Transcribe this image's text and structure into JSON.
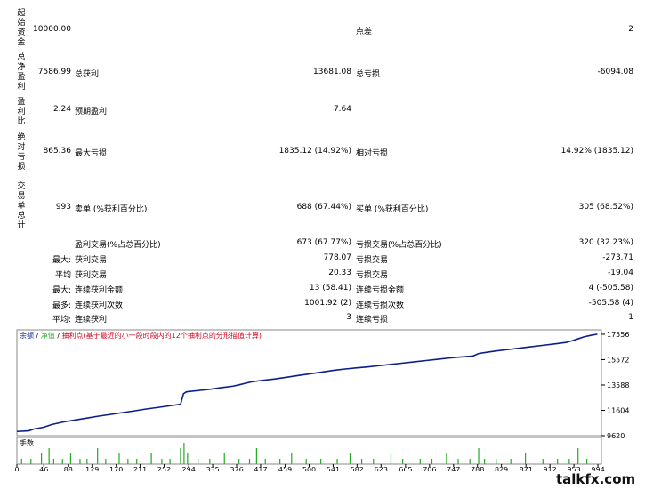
{
  "report": {
    "rows": [
      {
        "vlabel": "起始资金",
        "value": "10000.00",
        "c2label": "",
        "c2value": "",
        "c3label": "点差",
        "c3value": "2"
      },
      {
        "vlabel": "总净盈利",
        "value": "7586.99",
        "c2label": "总获利",
        "c2value": "13681.08",
        "c3label": "总亏损",
        "c3value": "-6094.08"
      },
      {
        "vlabel": "盈利比",
        "value": "2.24",
        "c2label": "预期盈利",
        "c2value": "7.64",
        "c3label": "",
        "c3value": ""
      },
      {
        "vlabel": "绝对亏损",
        "value": "865.36",
        "c2label": "最大亏损",
        "c2value": "1835.12 (14.92%)",
        "c3label": "相对亏损",
        "c3value": "14.92% (1835.12)"
      },
      {
        "vlabel": "交易单总计",
        "value": "993",
        "c2label": "卖单 (%获利百分比)",
        "c2value": "688 (67.44%)",
        "c3label": "买单 (%获利百分比)",
        "c3value": "305 (68.52%)"
      }
    ],
    "details": [
      {
        "prefix": "",
        "c2label": "盈利交易(%占总百分比)",
        "c2value": "673 (67.77%)",
        "c3label": "亏损交易(%占总百分比)",
        "c3value": "320 (32.23%)"
      },
      {
        "prefix": "最大:",
        "c2label": "获利交易",
        "c2value": "778.07",
        "c3label": "亏损交易",
        "c3value": "-273.71"
      },
      {
        "prefix": "平均",
        "c2label": "获利交易",
        "c2value": "20.33",
        "c3label": "亏损交易",
        "c3value": "-19.04"
      },
      {
        "prefix": "最大:",
        "c2label": "连续获利金额",
        "c2value": "13 (58.41)",
        "c3label": "连续亏损金额",
        "c3value": "4 (-505.58)"
      },
      {
        "prefix": "最多:",
        "c2label": "连续获利次数",
        "c2value": "1001.92 (2)",
        "c3label": "连续亏损次数",
        "c3value": "-505.58 (4)"
      },
      {
        "prefix": "平均:",
        "c2label": "连续获利",
        "c2value": "3",
        "c3label": "连续亏损",
        "c3value": "1"
      }
    ]
  },
  "chart": {
    "legend": {
      "balance": "余额",
      "sep1": " / ",
      "equity": "净值",
      "sep2": " / ",
      "drawdown": "抽利点(基于最近的小一段时段内的12个抽利点的分形描值计算)"
    },
    "volume_label": "手数",
    "colors": {
      "balance": "#0a1e8c",
      "equity": "#2ea82e",
      "drawdown": "#d0021b",
      "volume": "#22aa22",
      "border": "#888888"
    }
  },
  "chart_data": {
    "type": "line",
    "series": [
      {
        "x": [
          0,
          20,
          30,
          46,
          60,
          80,
          100,
          120,
          140,
          160,
          180,
          200,
          220,
          240,
          260,
          280,
          285,
          290,
          310,
          330,
          350,
          370,
          380,
          400,
          420,
          440,
          460,
          480,
          500,
          520,
          540,
          560,
          580,
          600,
          620,
          640,
          660,
          680,
          700,
          720,
          740,
          760,
          780,
          790,
          800,
          820,
          840,
          860,
          880,
          900,
          920,
          940,
          950,
          960,
          970,
          980,
          993
        ],
        "y": [
          9950,
          10000,
          10150,
          10280,
          10500,
          10700,
          10850,
          11000,
          11150,
          11280,
          11420,
          11550,
          11700,
          11820,
          11950,
          12080,
          12900,
          13050,
          13150,
          13250,
          13380,
          13500,
          13600,
          13820,
          13950,
          14050,
          14180,
          14320,
          14450,
          14580,
          14720,
          14830,
          14920,
          15000,
          15100,
          15200,
          15300,
          15400,
          15500,
          15600,
          15700,
          15780,
          15850,
          16050,
          16120,
          16250,
          16360,
          16470,
          16580,
          16690,
          16800,
          16920,
          17050,
          17200,
          17350,
          17450,
          17560
        ]
      }
    ],
    "xlim": [
      0,
      1000
    ],
    "ylim": [
      9620,
      17900
    ],
    "x_ticks": [
      0,
      46,
      88,
      129,
      170,
      211,
      252,
      294,
      335,
      376,
      417,
      459,
      500,
      541,
      582,
      623,
      665,
      706,
      747,
      788,
      829,
      871,
      912,
      953,
      994
    ],
    "y_ticks": [
      17556,
      15572,
      13588,
      11604,
      9620
    ],
    "volume": {
      "x": [
        8,
        24,
        42,
        55,
        63,
        78,
        92,
        108,
        120,
        138,
        152,
        175,
        190,
        205,
        230,
        248,
        262,
        280,
        286,
        292,
        310,
        330,
        355,
        380,
        398,
        410,
        425,
        450,
        470,
        495,
        520,
        548,
        570,
        590,
        610,
        640,
        660,
        690,
        710,
        735,
        755,
        775,
        790,
        800,
        820,
        845,
        870,
        900,
        925,
        945,
        960,
        975
      ],
      "values": [
        1,
        1,
        2,
        3,
        1,
        1,
        2,
        1,
        1,
        3,
        1,
        2,
        1,
        1,
        2,
        1,
        1,
        3,
        4,
        2,
        1,
        1,
        2,
        1,
        1,
        3,
        1,
        1,
        2,
        1,
        1,
        1,
        2,
        1,
        1,
        2,
        1,
        1,
        1,
        2,
        1,
        1,
        3,
        1,
        1,
        1,
        2,
        1,
        1,
        1,
        3,
        1
      ]
    }
  }
}
